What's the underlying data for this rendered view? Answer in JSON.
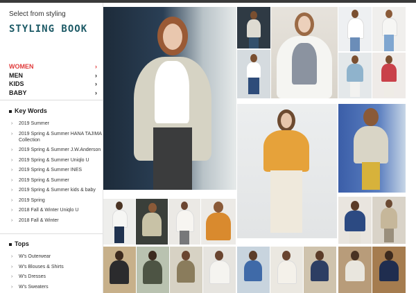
{
  "header": {
    "subtitle": "Select from styling",
    "title": "STYLING BOOK"
  },
  "colors": {
    "brand": "#1d5a66",
    "active": "#e03a3a",
    "text": "#1b1b1b"
  },
  "categories": [
    {
      "label": "WOMEN",
      "active": true,
      "icon": "chevron-right-icon"
    },
    {
      "label": "MEN",
      "active": false,
      "icon": "chevron-right-icon"
    },
    {
      "label": "KIDS",
      "active": false,
      "icon": "chevron-right-icon"
    },
    {
      "label": "BABY",
      "active": false,
      "icon": "chevron-right-icon"
    }
  ],
  "key_words": {
    "title": "Key Words",
    "items": [
      "2019 Summer",
      "2019 Spring & Summer HANA TAJIMA Collection",
      "2019 Spring & Summer J.W.Anderson",
      "2019 Spring & Summer Uniqlo U",
      "2019 Spring & Summer INES",
      "2019 Spring & Summer",
      "2019 Spring & Summer kids & baby",
      "2019 Spring",
      "2018 Fall & Winter Uniqlo U",
      "2018 Fall & Winter"
    ]
  },
  "tops": {
    "title": "Tops",
    "items": [
      "W's Outerwear",
      "W's Blouses & Shirts",
      "W's Dresses",
      "W's Sweaters"
    ]
  }
}
